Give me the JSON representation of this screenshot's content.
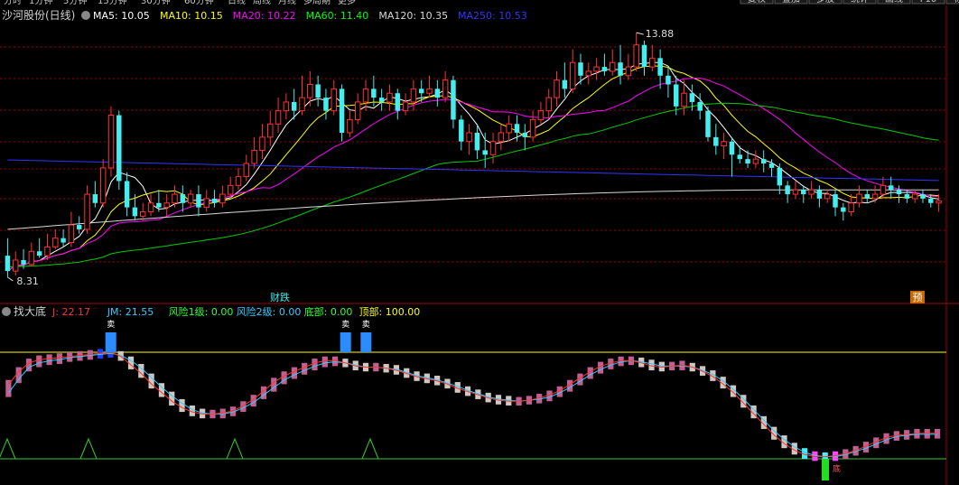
{
  "top_menu": {
    "periods": [
      "分时",
      "1分钟",
      "5分钟",
      "15分钟",
      "30分钟",
      "60分钟",
      "日线",
      "周线",
      "月线",
      "多周期",
      "更多"
    ],
    "buttons": [
      "复权",
      "叠加",
      "多股",
      "统计",
      "画线",
      "F10",
      "标记"
    ]
  },
  "main_panel": {
    "title": "沙河股份(日线)",
    "ma_legend": [
      {
        "label": "MA5: 10.05",
        "color": "#ffffff"
      },
      {
        "label": "MA10: 10.15",
        "color": "#ffff00"
      },
      {
        "label": "MA20: 10.22",
        "color": "#ff00ff"
      },
      {
        "label": "MA60: 11.40",
        "color": "#00ff00"
      },
      {
        "label": "MA120: 10.35",
        "color": "#d8d8d8"
      },
      {
        "label": "MA250: 10.53",
        "color": "#3333ff"
      }
    ],
    "price_high_label": "13.88",
    "price_low_label": "8.31",
    "event_labels": [
      "财跌",
      "预"
    ]
  },
  "sub_panel": {
    "title": "找大底",
    "legend": [
      {
        "label": "J: 22.17",
        "color": "#ff3333"
      },
      {
        "label": "JM: 21.55",
        "color": "#33ccff"
      },
      {
        "label": "风险1级: 0.00",
        "color": "#33ff33"
      },
      {
        "label": "风险2级: 0.00",
        "color": "#33ccff"
      },
      {
        "label": "底部: 0.00",
        "color": "#33ff33"
      },
      {
        "label": "顶部: 100.00",
        "color": "#ffff00"
      }
    ],
    "markers": [
      "卖",
      "卖",
      "卖",
      "底"
    ]
  },
  "colors": {
    "up": "#ff3333",
    "down": "#44eeee",
    "grid": "#a00000",
    "ma5": "#ffffff",
    "ma10": "#ffff00",
    "ma20": "#ff00ff",
    "ma60": "#00cc00",
    "ma120": "#d8d8d8",
    "ma250": "#3333ff"
  },
  "chart_data": [
    {
      "type": "candlestick",
      "title": "沙河股份(日线)",
      "ylim": [
        8.0,
        14.5
      ],
      "high_marker": 13.88,
      "low_marker": 8.31,
      "candles": [
        [
          8.8,
          8.45,
          9.2,
          8.31
        ],
        [
          8.45,
          8.7,
          8.9,
          8.35
        ],
        [
          8.7,
          8.6,
          8.95,
          8.5
        ],
        [
          8.6,
          8.9,
          9.1,
          8.55
        ],
        [
          8.9,
          8.8,
          9.2,
          8.75
        ],
        [
          8.8,
          9.0,
          9.3,
          8.7
        ],
        [
          9.0,
          9.2,
          9.4,
          8.95
        ],
        [
          9.2,
          9.1,
          9.4,
          9.0
        ],
        [
          9.1,
          9.5,
          9.8,
          9.0
        ],
        [
          9.5,
          9.4,
          9.7,
          9.3
        ],
        [
          9.4,
          10.2,
          10.4,
          9.3
        ],
        [
          10.2,
          10.0,
          10.5,
          9.9
        ],
        [
          10.0,
          10.8,
          11.0,
          9.9
        ],
        [
          10.8,
          12.0,
          12.2,
          10.6
        ],
        [
          12.0,
          10.5,
          12.1,
          10.3
        ],
        [
          10.5,
          9.9,
          10.7,
          9.7
        ],
        [
          9.9,
          9.7,
          10.2,
          9.6
        ],
        [
          9.7,
          9.8,
          10.0,
          9.6
        ],
        [
          9.8,
          10.0,
          10.2,
          9.7
        ],
        [
          10.0,
          9.9,
          10.3,
          9.8
        ],
        [
          9.9,
          10.0,
          10.2,
          9.7
        ],
        [
          10.0,
          10.2,
          10.4,
          9.9
        ],
        [
          10.2,
          10.0,
          10.4,
          9.8
        ],
        [
          10.0,
          10.2,
          10.3,
          9.9
        ],
        [
          10.2,
          9.9,
          10.4,
          9.7
        ],
        [
          9.9,
          10.1,
          10.3,
          9.8
        ],
        [
          10.1,
          10.0,
          10.3,
          9.9
        ],
        [
          10.0,
          10.2,
          10.4,
          9.9
        ],
        [
          10.2,
          10.4,
          10.6,
          10.1
        ],
        [
          10.4,
          10.6,
          10.8,
          10.3
        ],
        [
          10.6,
          10.9,
          11.1,
          10.5
        ],
        [
          10.9,
          11.2,
          11.5,
          10.8
        ],
        [
          11.2,
          11.5,
          11.8,
          11.0
        ],
        [
          11.5,
          11.8,
          12.1,
          11.3
        ],
        [
          11.8,
          12.1,
          12.4,
          11.6
        ],
        [
          12.1,
          12.3,
          12.5,
          11.9
        ],
        [
          12.3,
          12.1,
          12.6,
          11.9
        ],
        [
          12.1,
          12.4,
          12.9,
          12.0
        ],
        [
          12.4,
          12.7,
          13.0,
          12.2
        ],
        [
          12.7,
          12.4,
          12.9,
          12.2
        ],
        [
          12.4,
          12.1,
          12.6,
          11.9
        ],
        [
          12.1,
          12.6,
          12.8,
          12.0
        ],
        [
          12.6,
          11.6,
          12.7,
          11.4
        ],
        [
          11.6,
          11.9,
          12.1,
          11.5
        ],
        [
          11.9,
          12.3,
          12.5,
          11.8
        ],
        [
          12.3,
          12.6,
          12.8,
          12.1
        ],
        [
          12.6,
          12.4,
          12.9,
          12.2
        ],
        [
          12.4,
          12.3,
          12.6,
          12.1
        ],
        [
          12.3,
          12.5,
          12.7,
          12.1
        ],
        [
          12.5,
          12.1,
          12.6,
          11.9
        ],
        [
          12.1,
          12.3,
          12.5,
          12.0
        ],
        [
          12.3,
          12.6,
          12.8,
          12.1
        ],
        [
          12.6,
          12.5,
          12.8,
          12.3
        ],
        [
          12.5,
          12.6,
          12.9,
          12.4
        ],
        [
          12.6,
          12.4,
          12.8,
          12.2
        ],
        [
          12.4,
          12.8,
          13.0,
          12.3
        ],
        [
          12.8,
          11.9,
          12.9,
          11.7
        ],
        [
          11.9,
          11.4,
          12.0,
          11.2
        ],
        [
          11.4,
          11.6,
          11.8,
          11.1
        ],
        [
          11.6,
          11.2,
          11.8,
          11.0
        ],
        [
          11.2,
          11.1,
          11.6,
          10.8
        ],
        [
          11.1,
          11.4,
          11.6,
          10.9
        ],
        [
          11.4,
          11.6,
          11.8,
          11.2
        ],
        [
          11.6,
          11.8,
          12.0,
          11.4
        ],
        [
          11.8,
          11.6,
          12.0,
          11.4
        ],
        [
          11.6,
          11.5,
          11.8,
          11.2
        ],
        [
          11.5,
          11.9,
          12.1,
          11.4
        ],
        [
          11.9,
          12.1,
          12.3,
          11.8
        ],
        [
          12.1,
          12.4,
          12.6,
          11.9
        ],
        [
          12.4,
          12.8,
          13.0,
          12.2
        ],
        [
          12.8,
          12.6,
          13.2,
          12.4
        ],
        [
          12.6,
          13.2,
          13.5,
          12.5
        ],
        [
          13.2,
          12.9,
          13.4,
          12.7
        ],
        [
          12.9,
          13.0,
          13.2,
          12.7
        ],
        [
          13.0,
          13.1,
          13.3,
          12.8
        ],
        [
          13.1,
          13.0,
          13.4,
          12.9
        ],
        [
          13.0,
          13.2,
          13.5,
          12.9
        ],
        [
          13.2,
          12.9,
          13.6,
          12.7
        ],
        [
          12.9,
          13.1,
          13.4,
          12.8
        ],
        [
          13.1,
          13.6,
          13.88,
          13.0
        ],
        [
          13.6,
          13.1,
          13.7,
          12.9
        ],
        [
          13.1,
          13.3,
          13.6,
          13.0
        ],
        [
          13.3,
          12.9,
          13.5,
          12.6
        ],
        [
          12.9,
          12.7,
          13.1,
          12.4
        ],
        [
          12.7,
          12.2,
          12.9,
          12.0
        ],
        [
          12.2,
          12.5,
          12.8,
          12.0
        ],
        [
          12.5,
          12.3,
          12.7,
          12.1
        ],
        [
          12.3,
          12.1,
          12.5,
          11.9
        ],
        [
          12.1,
          11.5,
          12.2,
          11.4
        ],
        [
          11.5,
          11.3,
          11.8,
          11.1
        ],
        [
          11.3,
          11.4,
          11.6,
          11.0
        ],
        [
          11.4,
          11.1,
          11.5,
          10.6
        ],
        [
          11.1,
          11.0,
          11.3,
          10.9
        ],
        [
          11.0,
          10.9,
          11.2,
          10.8
        ],
        [
          10.9,
          11.0,
          11.2,
          10.8
        ],
        [
          11.0,
          10.9,
          11.2,
          10.7
        ],
        [
          10.9,
          10.8,
          11.0,
          10.6
        ],
        [
          10.8,
          10.4,
          10.9,
          10.2
        ],
        [
          10.4,
          10.2,
          10.5,
          10.0
        ],
        [
          10.2,
          10.3,
          10.5,
          10.1
        ],
        [
          10.3,
          10.2,
          10.4,
          10.0
        ],
        [
          10.2,
          10.3,
          10.5,
          10.1
        ],
        [
          10.3,
          10.1,
          10.4,
          9.9
        ],
        [
          10.1,
          10.2,
          10.3,
          10.0
        ],
        [
          10.2,
          9.9,
          10.3,
          9.7
        ],
        [
          9.9,
          9.8,
          10.0,
          9.6
        ],
        [
          9.8,
          10.0,
          10.2,
          9.7
        ],
        [
          10.0,
          10.2,
          10.4,
          9.9
        ],
        [
          10.2,
          10.1,
          10.3,
          10.0
        ],
        [
          10.1,
          10.2,
          10.4,
          10.0
        ],
        [
          10.2,
          10.4,
          10.6,
          10.1
        ],
        [
          10.4,
          10.3,
          10.6,
          10.1
        ],
        [
          10.3,
          10.2,
          10.4,
          10.0
        ],
        [
          10.2,
          10.1,
          10.3,
          10.0
        ],
        [
          10.1,
          10.2,
          10.3,
          10.0
        ],
        [
          10.2,
          10.1,
          10.3,
          10.0
        ],
        [
          10.1,
          10.0,
          10.2,
          9.9
        ],
        [
          10.0,
          10.05,
          10.2,
          9.8
        ]
      ]
    },
    {
      "type": "indicator",
      "title": "找大底",
      "ylim": [
        -8,
        108
      ],
      "top_line": 100,
      "bottom_line": 0,
      "series": [
        {
          "name": "J",
          "values": [
            70,
            82,
            90,
            93,
            94,
            95,
            96,
            97,
            98,
            99,
            100,
            96,
            88,
            80,
            70,
            62,
            54,
            48,
            44,
            42,
            42,
            43,
            45,
            50,
            56,
            64,
            72,
            78,
            82,
            86,
            90,
            92,
            92,
            90,
            87,
            86,
            86,
            85,
            83,
            80,
            77,
            75,
            73,
            70,
            66,
            63,
            60,
            57,
            55,
            54,
            54,
            55,
            57,
            60,
            64,
            70,
            76,
            82,
            87,
            90,
            92,
            92,
            90,
            87,
            86,
            87,
            88,
            86,
            82,
            77,
            70,
            62,
            52,
            42,
            32,
            22,
            14,
            8,
            4,
            2,
            2,
            3,
            5,
            8,
            12,
            16,
            20,
            22,
            23,
            24,
            24,
            24
          ]
        },
        {
          "name": "JM",
          "values": [
            62,
            75,
            86,
            90,
            92,
            93,
            95,
            96,
            97,
            98,
            99,
            97,
            92,
            85,
            76,
            67,
            59,
            52,
            46,
            43,
            42,
            42,
            44,
            48,
            53,
            60,
            67,
            74,
            79,
            83,
            87,
            90,
            91,
            90,
            88,
            86,
            86,
            85,
            84,
            81,
            78,
            76,
            74,
            71,
            68,
            64,
            61,
            58,
            56,
            55,
            54,
            55,
            56,
            58,
            62,
            67,
            73,
            79,
            84,
            88,
            91,
            92,
            91,
            89,
            87,
            87,
            87,
            86,
            83,
            79,
            73,
            65,
            56,
            46,
            36,
            26,
            18,
            11,
            6,
            3,
            2,
            2,
            4,
            7,
            10,
            14,
            18,
            21,
            22,
            23,
            23,
            23
          ]
        },
        {
          "name": "风险1级",
          "values": [
            0
          ]
        },
        {
          "name": "风险2级",
          "values": [
            0
          ]
        },
        {
          "name": "底部",
          "values": [
            0
          ]
        },
        {
          "name": "顶部",
          "values": [
            100
          ]
        }
      ]
    }
  ]
}
